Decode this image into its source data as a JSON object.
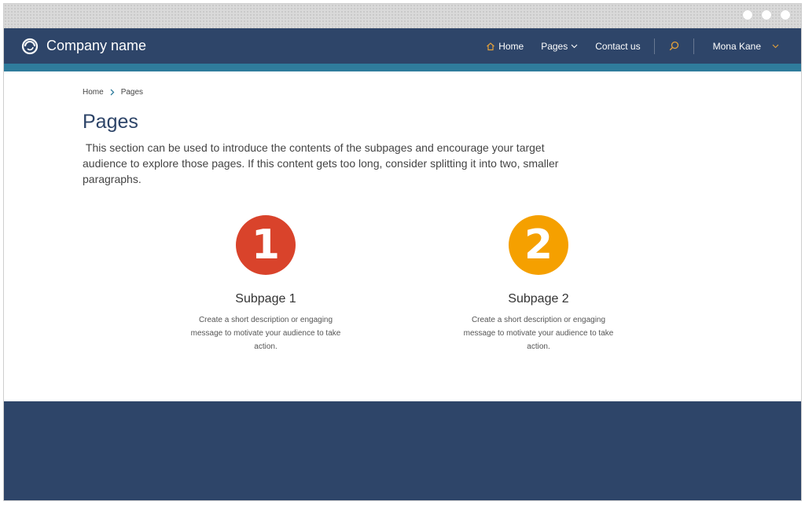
{
  "colors": {
    "navbar": "#2e4569",
    "accent_bar": "#2f7c9c",
    "footer": "#2e4569",
    "title": "#2e4569",
    "home_icon": "#e5a23a",
    "search_icon": "#e5a23a",
    "breadcrumb_chevron": "#2f7c9c",
    "circle_1": "#d9432b",
    "circle_2": "#f5a000"
  },
  "header": {
    "logo_icon": "ring-logo-icon",
    "brand": "Company name",
    "nav": {
      "home": "Home",
      "pages": "Pages",
      "contact": "Contact us"
    },
    "search_icon": "search-icon",
    "user": "Mona Kane"
  },
  "breadcrumb": {
    "home": "Home",
    "current": "Pages"
  },
  "main": {
    "title": "Pages",
    "intro": " This section can be used to introduce the contents of the subpages and encourage your target audience to explore those pages. If this content gets too long, consider splitting it into two, smaller paragraphs."
  },
  "cards": [
    {
      "number": "1",
      "title": "Subpage 1",
      "description": "Create a short description or engaging message to motivate your audience to take action."
    },
    {
      "number": "2",
      "title": "Subpage 2",
      "description": "Create a short description or engaging message to motivate your audience to take action."
    }
  ]
}
